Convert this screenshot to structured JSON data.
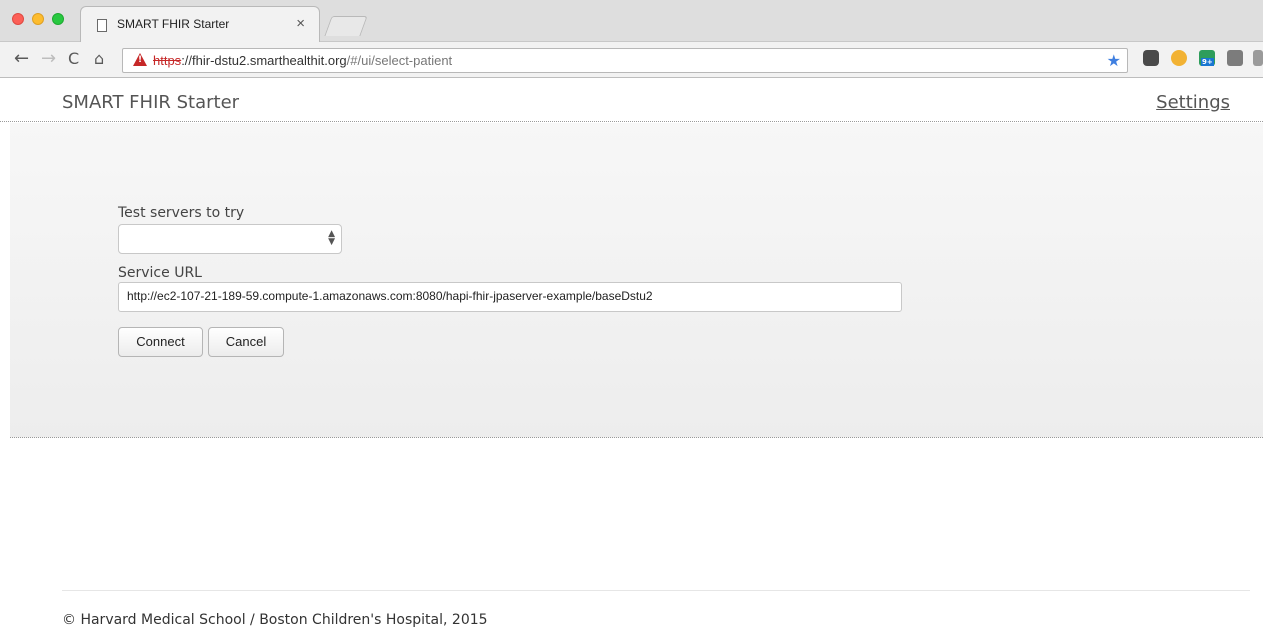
{
  "browser": {
    "tab_title": "SMART FHIR Starter",
    "tab_close": "×",
    "url_scheme": "https",
    "url_rest": "://fhir-dstu2.smarthealthit.org",
    "url_path": "/#/ui/select-patient"
  },
  "navbar": {
    "brand": "SMART FHIR Starter",
    "settings_label": "Settings"
  },
  "form": {
    "test_servers_label": "Test servers to try",
    "test_servers_selected": "",
    "service_url_label": "Service URL",
    "service_url_value": "http://ec2-107-21-189-59.compute-1.amazonaws.com:8080/hapi-fhir-jpaserver-example/baseDstu2",
    "connect_label": "Connect",
    "cancel_label": "Cancel"
  },
  "footer": {
    "text": "© Harvard Medical School / Boston Children's Hospital, 2015"
  },
  "colors": {
    "insecure_scheme": "#c62828",
    "bookmark_star": "#3f7fe0"
  }
}
